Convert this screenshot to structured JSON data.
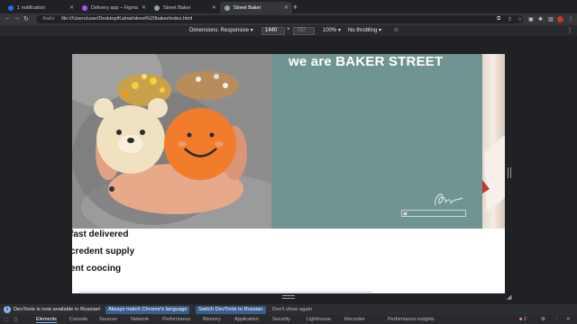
{
  "browser": {
    "tabs": [
      {
        "label": "1 notification",
        "active": false,
        "favicon_color": "#1a73e8"
      },
      {
        "label": "Delivery app – Figma",
        "active": false,
        "favicon_color": "#a259ff"
      },
      {
        "label": "Street Baker",
        "active": false,
        "favicon_color": "#9aa0a6"
      },
      {
        "label": "Street Baker",
        "active": true,
        "favicon_color": "#9aa0a6"
      }
    ],
    "new_tab": "+",
    "url_scheme": "Файл",
    "url": "file:///Users/user/Desktop/Kainat/street%20baker/index.html"
  },
  "devtools_toolbar": {
    "dimensions_label": "Dimensions: Responsive",
    "width_value": "1440",
    "times": "×",
    "height_value": "797",
    "zoom": "100%",
    "throttling": "No throttling"
  },
  "page": {
    "headline": "we are BAKER STREET",
    "features": [
      "fast delivered",
      "credent supply",
      "ent coocing"
    ],
    "teal_color": "#6f9491"
  },
  "infobar": {
    "message": "DevTools is now available in Russian!",
    "match_button": "Always match Chrome's language",
    "switch_button": "Switch DevTools to Russian",
    "dismiss": "Don't show again"
  },
  "devtools_tabs": [
    "Elements",
    "Console",
    "Sources",
    "Network",
    "Performance",
    "Memory",
    "Application",
    "Security",
    "Lighthouse",
    "Recorder",
    "Performance insights"
  ],
  "devtools_badge": "2"
}
